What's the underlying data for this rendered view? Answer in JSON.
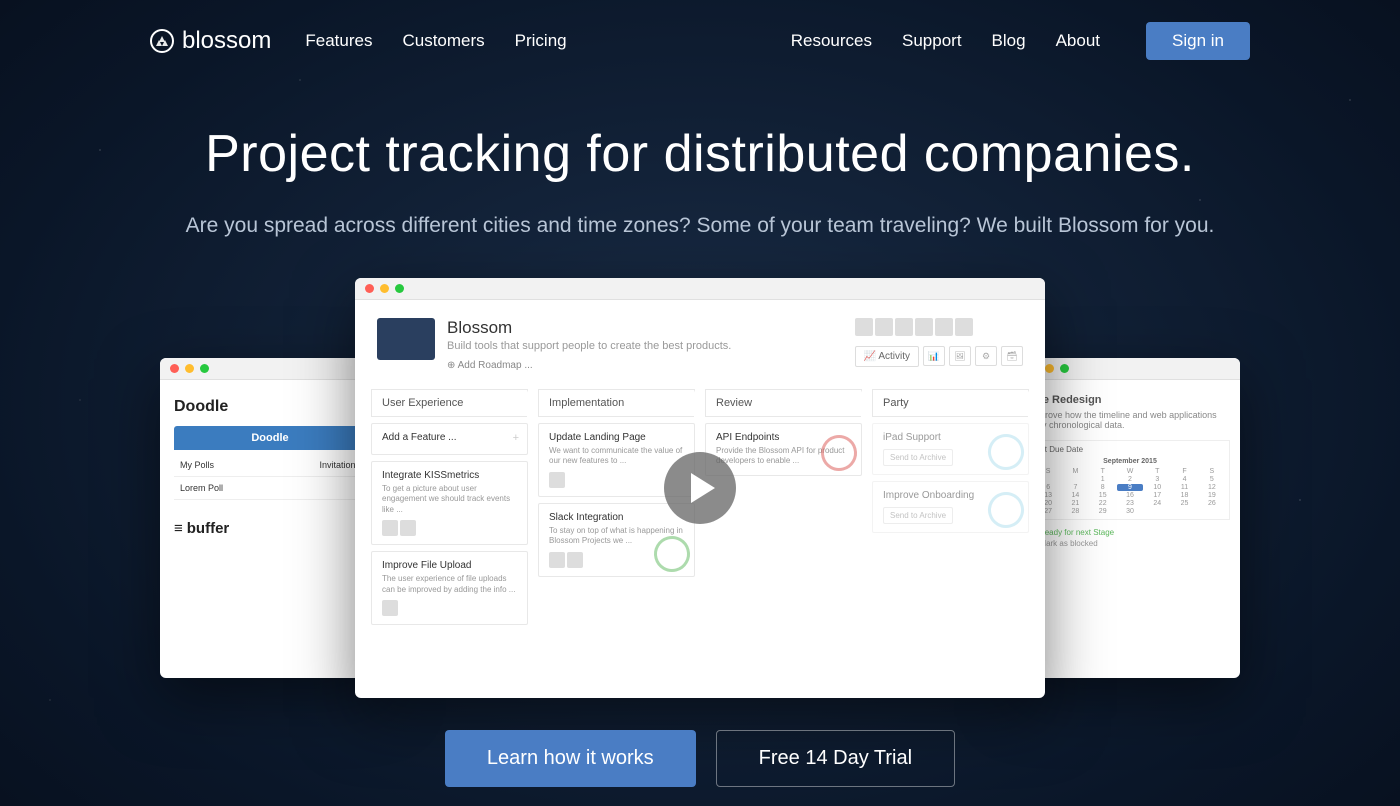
{
  "brand": "blossom",
  "nav_left": [
    "Features",
    "Customers",
    "Pricing"
  ],
  "nav_right": [
    "Resources",
    "Support",
    "Blog",
    "About"
  ],
  "signin": "Sign in",
  "hero": {
    "title": "Project tracking for distributed companies.",
    "subtitle": "Are you spread across different cities and time zones? Some of your team traveling? We built Blossom for you."
  },
  "left_window": {
    "app1": "Doodle",
    "tab_label": "Doodle",
    "row1a": "My Polls",
    "row1b": "Invitations",
    "row2": "Lorem Poll",
    "app2": "buffer"
  },
  "right_window": {
    "title": "line Redesign",
    "desc": "Improve how the timeline and web applications play chronological data.",
    "due_label": "Set Due Date",
    "calendar_title": "September 2015",
    "ready": "Ready for next Stage",
    "blocked": "Mark as blocked"
  },
  "main": {
    "title": "Blossom",
    "subtitle": "Build tools that support people to create the best products.",
    "add_roadmap": "⊕ Add Roadmap ...",
    "activity": "Activity",
    "columns": [
      "User Experience",
      "Implementation",
      "Review",
      "Party"
    ],
    "cards_ux": [
      {
        "title": "Add a Feature ..."
      },
      {
        "title": "Integrate KISSmetrics",
        "desc": "To get a picture about user engagement we should track events like ..."
      },
      {
        "title": "Improve File Upload",
        "desc": "The user experience of file uploads can be improved by adding the info ..."
      }
    ],
    "cards_impl": [
      {
        "title": "Update Landing Page",
        "desc": "We want to communicate the value of our new features to ..."
      },
      {
        "title": "Slack Integration",
        "desc": "To stay on top of what is happening in Blossom Projects we ..."
      }
    ],
    "cards_review": [
      {
        "title": "API Endpoints",
        "desc": "Provide the Blossom API for product developers to enable ..."
      }
    ],
    "cards_party": [
      {
        "title": "iPad Support",
        "archive": "Send to Archive"
      },
      {
        "title": "Improve Onboarding",
        "archive": "Send to Archive"
      }
    ]
  },
  "cta": {
    "learn": "Learn how it works",
    "trial": "Free 14 Day Trial"
  }
}
